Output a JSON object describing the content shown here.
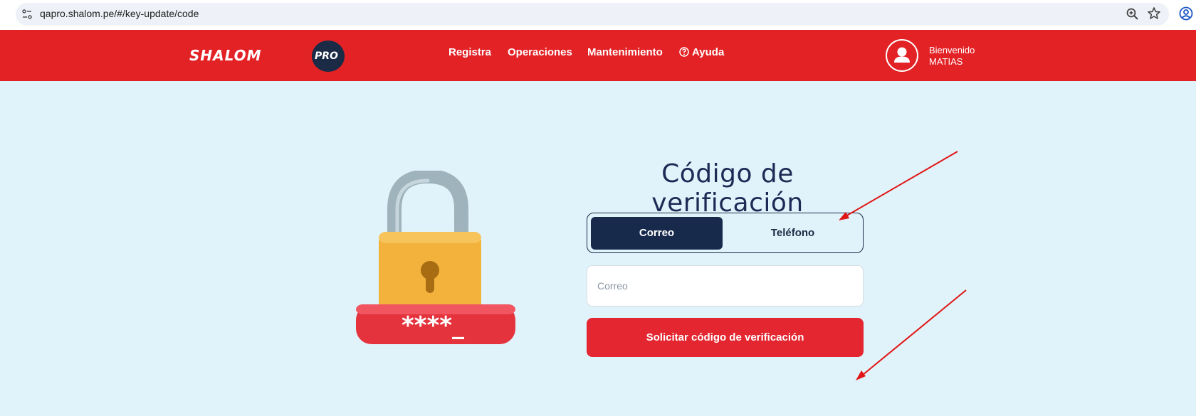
{
  "browser": {
    "url": "qapro.shalom.pe/#/key-update/code"
  },
  "header": {
    "logo_text": "SHALOM",
    "logo_badge": "PRO",
    "nav": [
      "Registra",
      "Operaciones",
      "Mantenimiento",
      "Ayuda"
    ],
    "greeting": "Bienvenido",
    "username": "MATIAS",
    "brand_color": "#e32226"
  },
  "main": {
    "title": "Código de verificación",
    "tabs": [
      {
        "label": "Correo",
        "selected": true
      },
      {
        "label": "Teléfono",
        "selected": false
      }
    ],
    "email_input": {
      "placeholder": "Correo",
      "value": ""
    },
    "submit_label": "Solicitar código de verificación",
    "lock_code": "****_",
    "accent_dark": "#182a4c",
    "accent_red": "#e32630",
    "background": "#e1f3fa"
  }
}
